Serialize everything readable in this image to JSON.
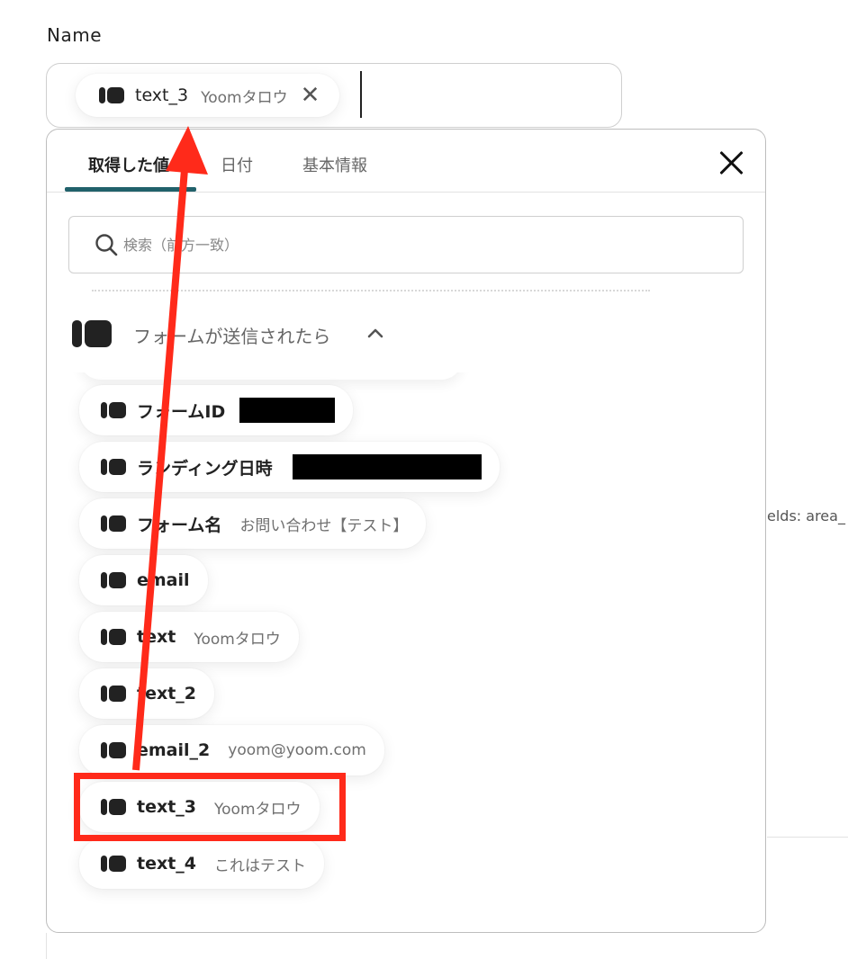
{
  "field": {
    "label": "Name"
  },
  "selected_chip": {
    "key": "text_3",
    "value": "Yoomタロウ",
    "remove_glyph": "✕"
  },
  "panel": {
    "tabs": [
      {
        "label": "取得した値",
        "active": true
      },
      {
        "label": "日付",
        "active": false
      },
      {
        "label": "基本情報",
        "active": false
      }
    ],
    "search": {
      "placeholder": "検索（前方一致）",
      "value": ""
    },
    "group": {
      "title": "フォームが送信されたら",
      "expanded": true
    },
    "items": [
      {
        "key": "フォームID",
        "value": "",
        "redacted": true
      },
      {
        "key": "ランディング日時",
        "value": "",
        "redacted": true
      },
      {
        "key": "フォーム名",
        "value": "お問い合わせ【テスト】"
      },
      {
        "key": "email",
        "value": ""
      },
      {
        "key": "text",
        "value": "Yoomタロウ"
      },
      {
        "key": "text_2",
        "value": ""
      },
      {
        "key": "email_2",
        "value": "yoom@yoom.com"
      },
      {
        "key": "text_3",
        "value": "Yoomタロウ"
      },
      {
        "key": "text_4",
        "value": "これはテスト"
      }
    ]
  },
  "background": {
    "fragment": "elds: area_"
  },
  "annotation": {
    "highlight_color": "#ff2a1a",
    "arrow_color": "#ff2a1a"
  },
  "colors": {
    "tab_accent": "#21616b"
  }
}
